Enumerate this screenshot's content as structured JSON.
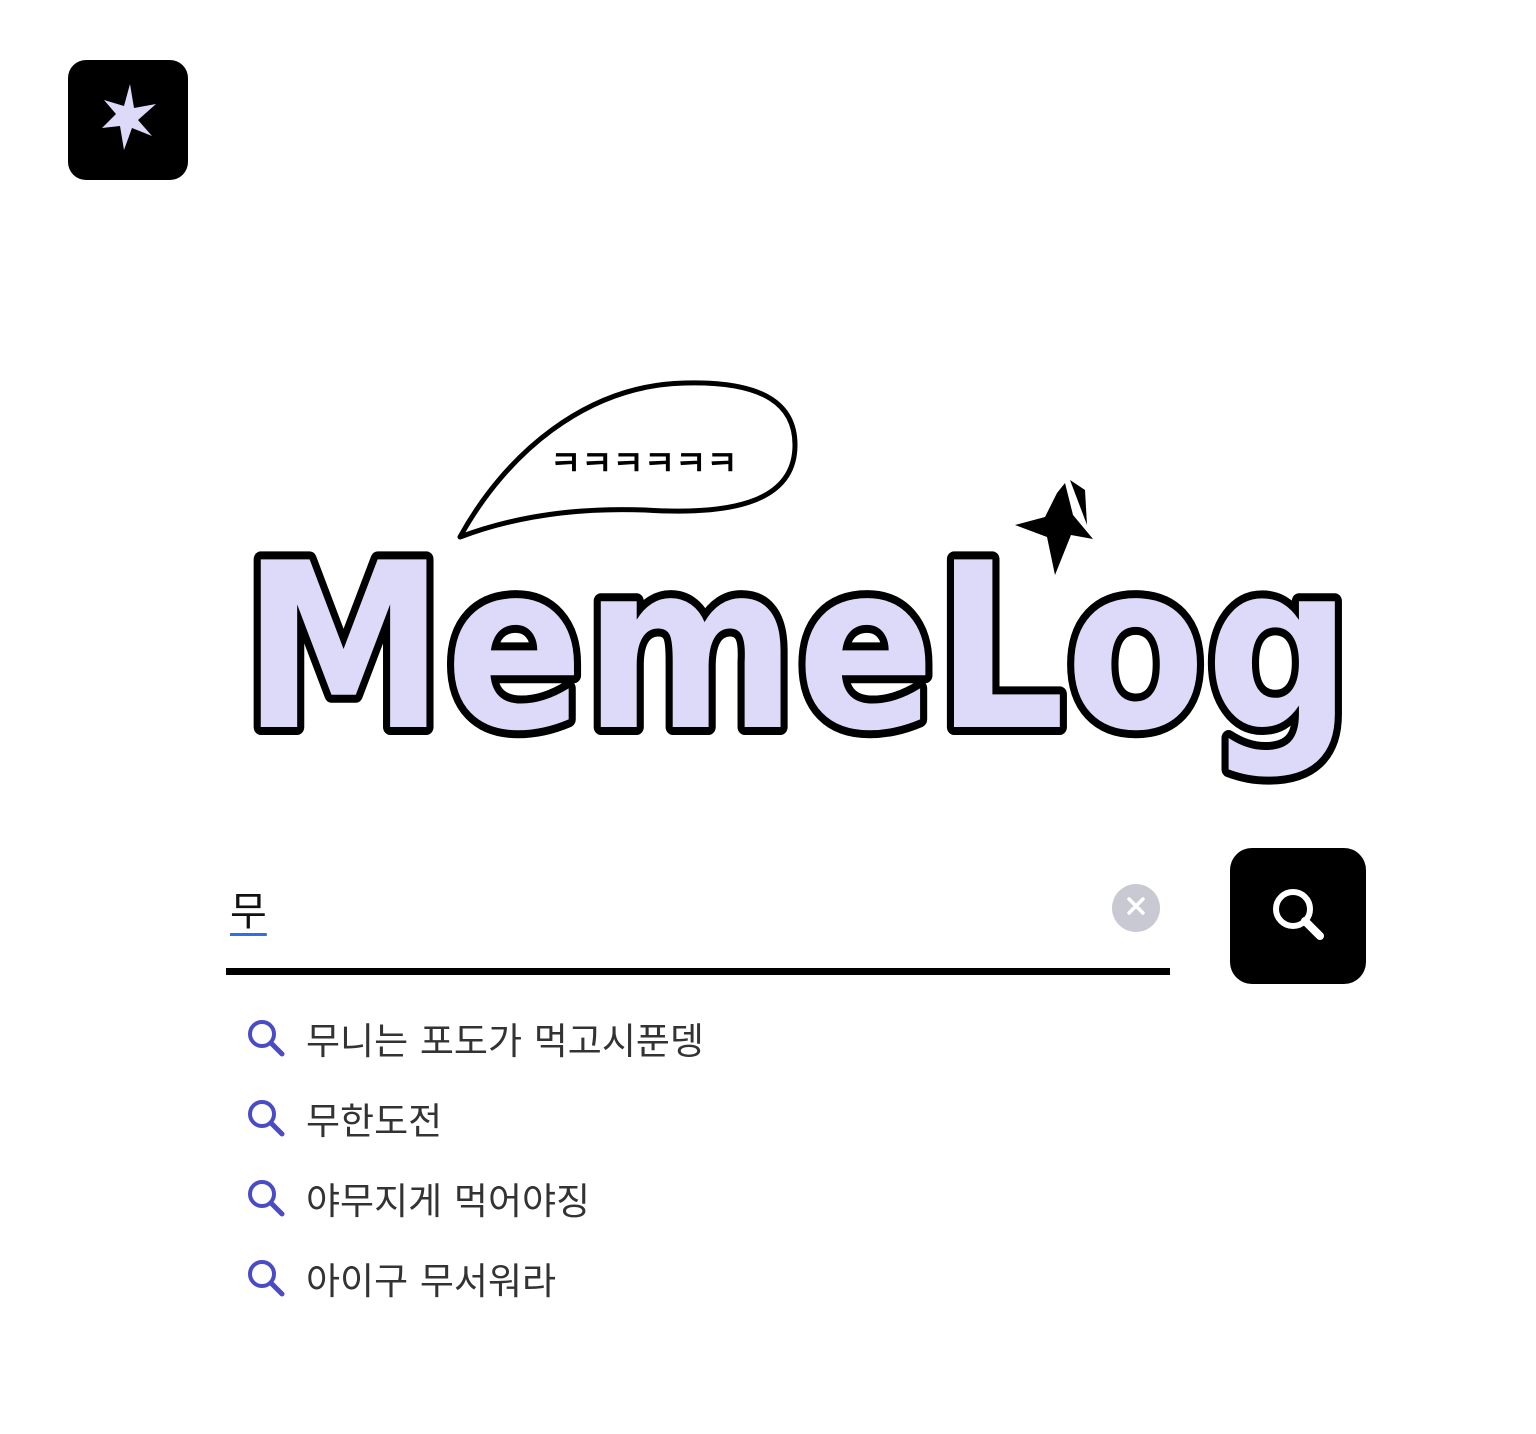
{
  "app_icon": {
    "icon": "sparkle-icon",
    "color": "#dcdaf8"
  },
  "logo": {
    "text": "MemeLog",
    "bubble_text": "ㅋㅋㅋㅋㅋㅋ",
    "fill_color": "#dcdaf8",
    "outline_color": "#000000"
  },
  "search": {
    "value": "무",
    "placeholder": "",
    "clear_icon": "close-icon",
    "button_icon": "search-icon"
  },
  "suggestions": [
    {
      "label": "무니는 포도가 먹고시푼뎅"
    },
    {
      "label": "무한도전"
    },
    {
      "label": "야무지게 먹어야징"
    },
    {
      "label": "아이구 무서워라"
    }
  ],
  "colors": {
    "accent": "#4b4bc8",
    "suggestion_text": "#333333",
    "clear_bg": "#c9c9d3"
  }
}
